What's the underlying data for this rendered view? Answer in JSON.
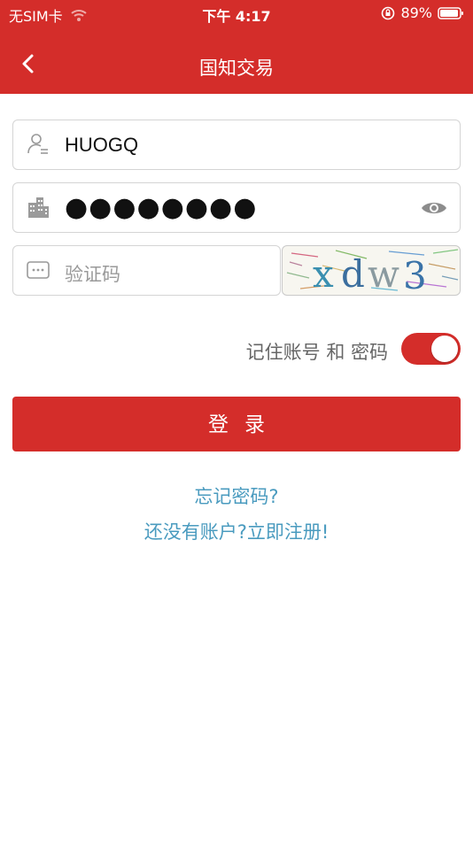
{
  "status_bar": {
    "carrier": "无SIM卡",
    "time": "下午 4:17",
    "battery": "89%"
  },
  "nav": {
    "title": "国知交易"
  },
  "form": {
    "username_value": "HUOGQ",
    "password_mask": "●●●●●●●●",
    "captcha_placeholder": "验证码",
    "captcha_text": "xdw3",
    "remember_label": "记住账号 和 密码",
    "remember_on": true,
    "login_label": "登录"
  },
  "links": {
    "forgot": "忘记密码?",
    "register": "还没有账户?立即注册!"
  },
  "colors": {
    "brand": "#d42d2a",
    "link": "#4a9bbf"
  }
}
